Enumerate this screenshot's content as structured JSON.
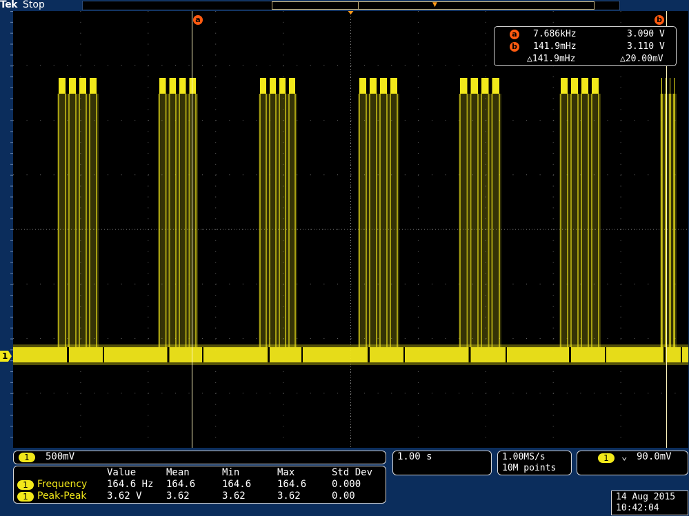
{
  "header": {
    "brand": "Tek",
    "acq_state": "Stop"
  },
  "cursors": {
    "a_label": "a",
    "b_label": "b"
  },
  "readout": {
    "a_marker": "a",
    "a_freq": "7.686kHz",
    "a_volt": "3.090 V",
    "b_marker": "b",
    "b_freq": "141.9mHz",
    "b_volt": "3.110 V",
    "delta_freq": "△141.9mHz",
    "delta_volt": "△20.00mV"
  },
  "channel": {
    "number": "1",
    "scale": "500mV",
    "color": "#f2e81a"
  },
  "timebase": {
    "scale": "1.00 s",
    "sample_rate": "1.00MS/s",
    "record_length": "10M points"
  },
  "trigger": {
    "source": "1",
    "slope_symbol": "⌄",
    "level": "90.0mV"
  },
  "measurements": {
    "headers": [
      "Value",
      "Mean",
      "Min",
      "Max",
      "Std Dev"
    ],
    "rows": [
      {
        "channel": "1",
        "name": "Frequency",
        "value": "164.6 Hz",
        "mean": "164.6",
        "min": "164.6",
        "max": "164.6",
        "stddev": "0.000"
      },
      {
        "channel": "1",
        "name": "Peak-Peak",
        "value": "3.62 V",
        "mean": "3.62",
        "min": "3.62",
        "max": "3.62",
        "stddev": "0.00"
      }
    ]
  },
  "datetime": {
    "date": "14 Aug 2015",
    "time": "10:42:04"
  },
  "colors": {
    "trace": "#f2e81a",
    "cursor": "#fff6c0",
    "marker": "#ff5a10",
    "bezel": "#0b2d5c"
  }
}
